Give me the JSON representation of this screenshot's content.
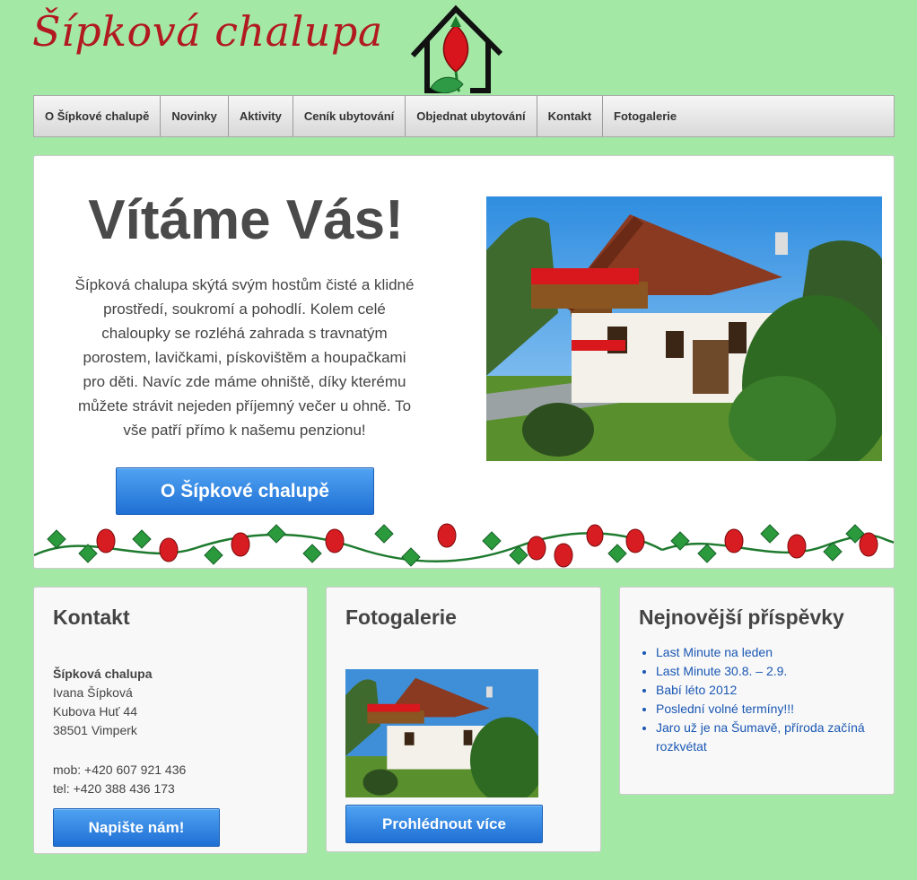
{
  "site": {
    "logo_text": "Šípková chalupa",
    "brand_color": "#b11a1f",
    "background": "#a4e8a6"
  },
  "nav": {
    "items": [
      {
        "label": "O Šípkové chalupě"
      },
      {
        "label": "Novinky"
      },
      {
        "label": "Aktivity"
      },
      {
        "label": "Ceník ubytování"
      },
      {
        "label": "Objednat ubytování"
      },
      {
        "label": "Kontakt"
      },
      {
        "label": "Fotogalerie"
      }
    ]
  },
  "hero": {
    "title": "Vítáme Vás!",
    "text": "Šípková chalupa skýtá svým hostům čisté a klidné prostředí, soukromí a pohodlí. Kolem celé chaloupky se rozléhá zahrada s travnatým porostem, lavičkami, pískovištěm a houpačkami pro děti. Navíc zde máme ohniště, díky kterému můžete strávit nejeden příjemný večer u ohně. To vše patří přímo k našemu penzionu!",
    "button": "O Šípkové chalupě",
    "accent": "#2a7fe0"
  },
  "contact": {
    "title": "Kontakt",
    "name": "Šípková chalupa",
    "person": "Ivana Šípková",
    "street": "Kubova Huť 44",
    "city": "38501 Vimperk",
    "mobile": "mob: +420 607 921 436",
    "phone": "tel: +420 388 436 173",
    "button": "Napište nám!"
  },
  "gallery": {
    "title": "Fotogalerie",
    "button": "Prohlédnout více"
  },
  "news": {
    "title": "Nejnovější příspěvky",
    "items": [
      {
        "label": "Last Minute na leden"
      },
      {
        "label": "Last Minute 30.8. – 2.9."
      },
      {
        "label": "Babí léto 2012"
      },
      {
        "label": "Poslední volné termíny!!!"
      },
      {
        "label": "Jaro už je na Šumavě, příroda začíná rozkvétat"
      }
    ]
  }
}
